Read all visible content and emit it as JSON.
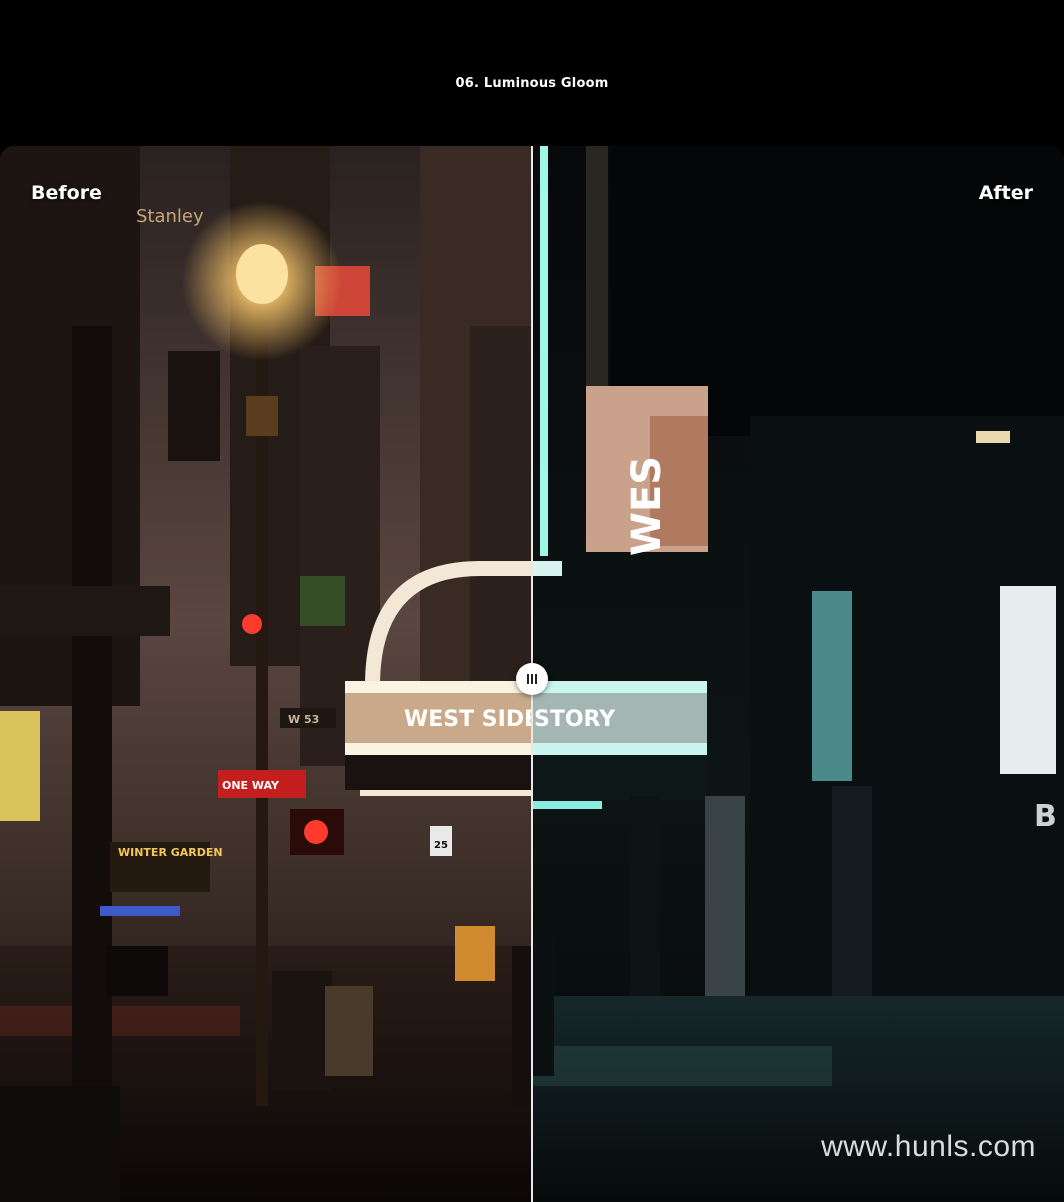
{
  "header": {
    "title": "06. Luminous Gloom"
  },
  "comparison": {
    "before_label": "Before",
    "after_label": "After",
    "split_percent": 50
  },
  "scene": {
    "sign_stanley": "Stanley",
    "marquee_text": "WEST SIDE STORY",
    "sign_one_way": "ONE WAY",
    "sign_speed": "25",
    "sign_street": "W 53",
    "poster_text": "WES",
    "sign_winter_garden": "WINTER GARDEN",
    "wall_letter": "B"
  },
  "watermark": "www.hunls.com",
  "colors": {
    "before_accent": "#f3c87a",
    "after_accent": "#7ef3e0",
    "background": "#000000"
  },
  "icons": {
    "divider_handle": "grip-vertical-icon"
  }
}
